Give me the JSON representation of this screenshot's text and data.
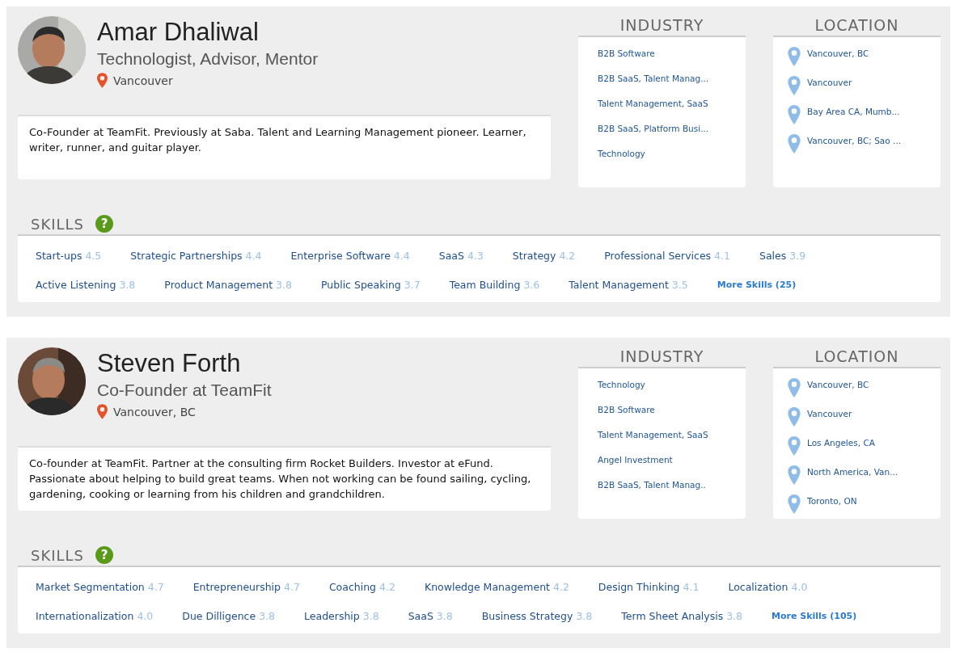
{
  "profiles": [
    {
      "name": "Amar Dhaliwal",
      "headline": "Technologist, Advisor, Mentor",
      "location": "Vancouver",
      "bio": "Co-Founder at TeamFit. Previously at Saba. Talent and Learning Management pioneer. Learner, writer, runner, and guitar player.",
      "industry": {
        "title": "INDUSTRY",
        "items": [
          "B2B Software",
          "B2B SaaS, Talent Manag...",
          "Talent Management, SaaS",
          "B2B SaaS, Platform Busi...",
          "Technology"
        ]
      },
      "locations": {
        "title": "LOCATION",
        "items": [
          "Vancouver, BC",
          "Vancouver",
          "Bay Area CA, Mumb...",
          "Vancouver, BC; Sao ..."
        ]
      },
      "skills": {
        "title": "SKILLS",
        "help_icon": "?",
        "more": "More Skills (25)",
        "items": [
          {
            "name": "Start-ups",
            "score": "4.5"
          },
          {
            "name": "Strategic Partnerships",
            "score": "4.4"
          },
          {
            "name": "Enterprise Software",
            "score": "4.4"
          },
          {
            "name": "SaaS",
            "score": "4.3"
          },
          {
            "name": "Strategy",
            "score": "4.2"
          },
          {
            "name": "Professional Services",
            "score": "4.1"
          },
          {
            "name": "Sales",
            "score": "3.9"
          },
          {
            "name": "Active Listening",
            "score": "3.8"
          },
          {
            "name": "Product Management",
            "score": "3.8"
          },
          {
            "name": "Public Speaking",
            "score": "3.7"
          },
          {
            "name": "Team Building",
            "score": "3.6"
          },
          {
            "name": "Talent Management",
            "score": "3.5"
          }
        ]
      }
    },
    {
      "name": "Steven Forth",
      "headline": "Co-Founder at TeamFit",
      "location": "Vancouver, BC",
      "bio": "Co-founder at TeamFit. Partner at the consulting firm Rocket Builders. Investor at eFund. Passionate about helping to build great teams. When not working can be found sailing, cycling, gardening, cooking or learning from his children and grandchildren.",
      "industry": {
        "title": "INDUSTRY",
        "items": [
          "Technology",
          "B2B Software",
          "Talent Management, SaaS",
          "Angel Investment",
          "B2B SaaS, Talent Manag.."
        ]
      },
      "locations": {
        "title": "LOCATION",
        "items": [
          "Vancouver, BC",
          "Vancouver",
          "Los Angeles, CA",
          "North America, Van...",
          "Toronto, ON"
        ]
      },
      "skills": {
        "title": "SKILLS",
        "help_icon": "?",
        "more": "More Skills (105)",
        "items": [
          {
            "name": "Market Segmentation",
            "score": "4.7"
          },
          {
            "name": "Entrepreneurship",
            "score": "4.7"
          },
          {
            "name": "Coaching",
            "score": "4.2"
          },
          {
            "name": "Knowledge Management",
            "score": "4.2"
          },
          {
            "name": "Design Thinking",
            "score": "4.1"
          },
          {
            "name": "Localization",
            "score": "4.0"
          },
          {
            "name": "Internationalization",
            "score": "4.0"
          },
          {
            "name": "Due Dilligence",
            "score": "3.8"
          },
          {
            "name": "Leadership",
            "score": "3.8"
          },
          {
            "name": "SaaS",
            "score": "3.8"
          },
          {
            "name": "Business Strategy",
            "score": "3.8"
          },
          {
            "name": "Term Sheet Analysis",
            "score": "3.8"
          }
        ]
      }
    }
  ]
}
